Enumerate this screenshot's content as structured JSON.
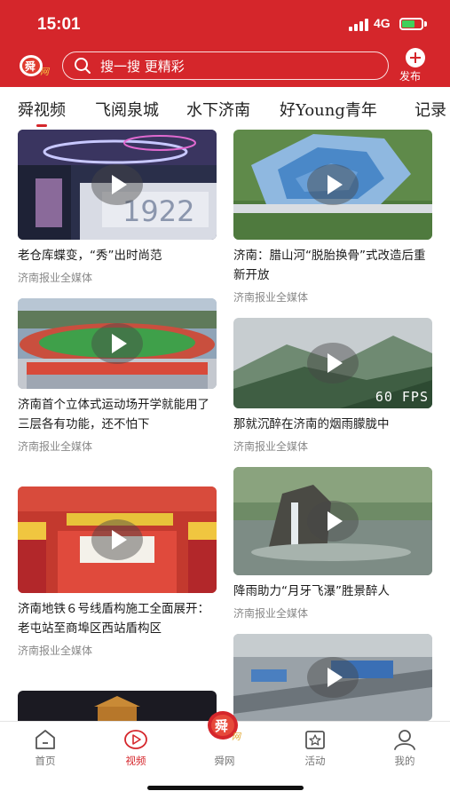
{
  "status_bar": {
    "time": "15:01",
    "network": "4G"
  },
  "colors": {
    "brand_red": "#d5262b",
    "battery_green": "#3fd15a"
  },
  "header": {
    "logo_icon": "shun-logo-icon",
    "search_placeholder": "搜一搜 更精彩",
    "publish_label": "发布"
  },
  "tabs": [
    {
      "label": "舜视频",
      "active": true
    },
    {
      "label": "飞阅泉城",
      "active": false
    },
    {
      "label": "水下济南",
      "active": false
    },
    {
      "label": "好Young青年",
      "active": false
    },
    {
      "label": "记录",
      "active": false
    }
  ],
  "feed": {
    "left": [
      {
        "title": "老仓库蝶变，“秀”出时尚范",
        "source": "济南报业全媒体"
      },
      {
        "title": "济南首个立体式运动场开学就能用了 三层各有功能，还不怕下",
        "source": "济南报业全媒体"
      },
      {
        "title": "济南地铁６号线盾构施工全面展开：老屯站至商埠区西站盾构区",
        "source": "济南报业全媒体"
      },
      {
        "title": "",
        "source": ""
      }
    ],
    "right": [
      {
        "title": "济南：腊山河“脱胎换骨”式改造后重新开放",
        "source": "济南报业全媒体"
      },
      {
        "title": "那就沉醉在济南的烟雨朦胧中",
        "source": "济南报业全媒体",
        "overlay": "60 FPS"
      },
      {
        "title": "降雨助力“月牙飞瀑”胜景醉人",
        "source": "济南报业全媒体"
      },
      {
        "title": "",
        "source": ""
      }
    ]
  },
  "bottom_nav": [
    {
      "label": "首页",
      "icon": "home-icon",
      "active": false
    },
    {
      "label": "视频",
      "icon": "video-icon",
      "active": true
    },
    {
      "label": "舜网",
      "icon": "shun-logo-icon",
      "active": false
    },
    {
      "label": "活动",
      "icon": "star-calendar-icon",
      "active": false
    },
    {
      "label": "我的",
      "icon": "user-icon",
      "active": false
    }
  ]
}
